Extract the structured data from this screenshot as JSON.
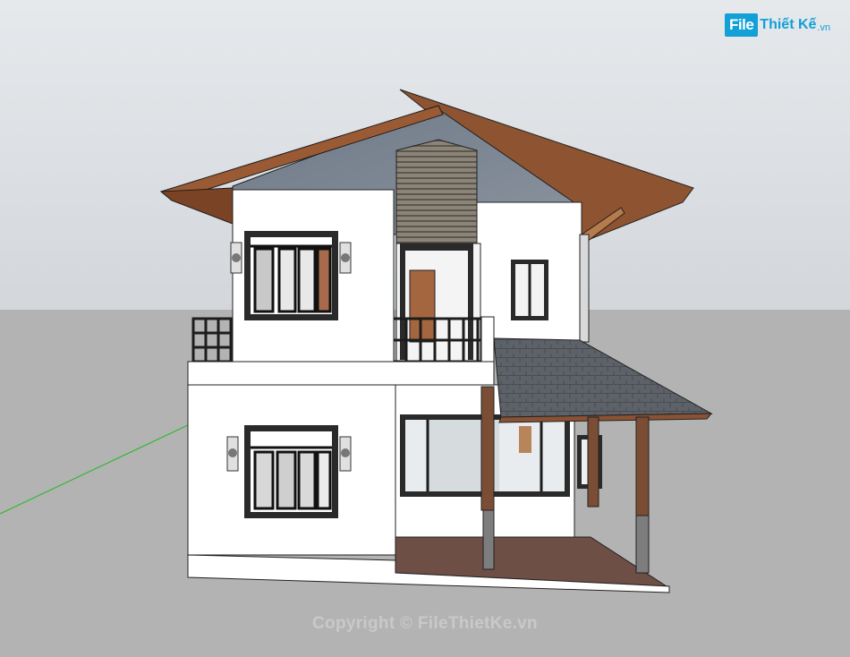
{
  "logo": {
    "part1": "File",
    "part2": "Thiết Kế",
    "part3": ".vn"
  },
  "watermark": "Copyright © FileThietKe.vn",
  "colors": {
    "sky": "#dde1e5",
    "ground": "#b3b3b3",
    "roof_wood": "#9a5b34",
    "wall": "#ffffff",
    "gable": "#7d8794",
    "porch_roof": "#5c6068",
    "brand": "#12a0d7"
  }
}
